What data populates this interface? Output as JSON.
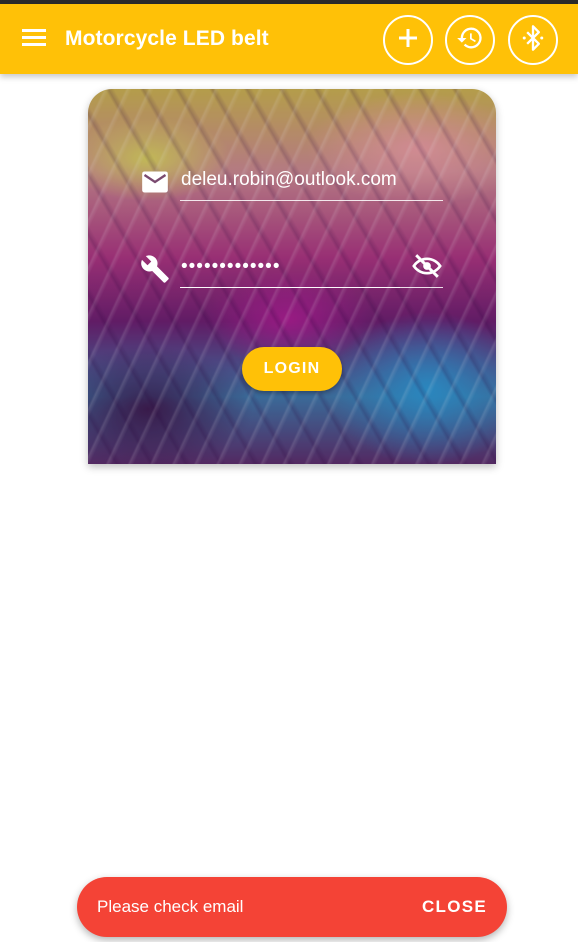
{
  "appbar": {
    "title": "Motorcycle LED belt",
    "menu_icon": "menu-icon",
    "actions": [
      {
        "name": "add",
        "icon": "plus-icon"
      },
      {
        "name": "history",
        "icon": "history-icon"
      },
      {
        "name": "bluetooth",
        "icon": "bluetooth-searching-icon"
      }
    ],
    "color": "#FFC107"
  },
  "login": {
    "email_icon": "mail-icon",
    "email_value": "deleu.robin@outlook.com",
    "password_icon": "wrench-icon",
    "password_value": "•••••••••••••",
    "visibility_icon": "eye-off-icon",
    "login_label": "LOGIN",
    "button_color": "#FFC107"
  },
  "snackbar": {
    "message": "Please check email",
    "action_label": "CLOSE",
    "color": "#F44336"
  }
}
